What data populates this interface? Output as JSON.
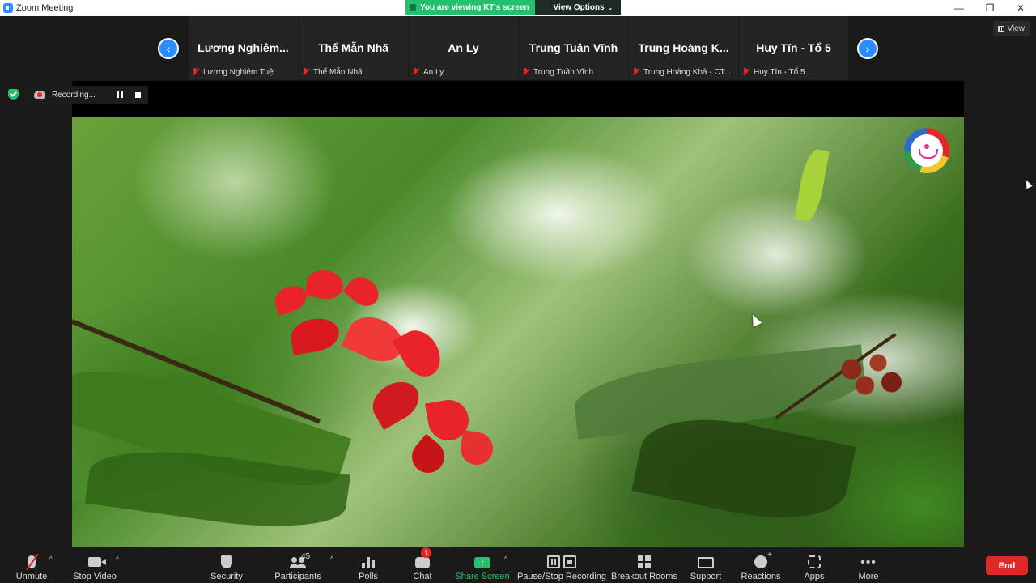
{
  "window": {
    "title": "Zoom Meeting",
    "minimize": "—",
    "restore": "❐",
    "close": "✕"
  },
  "banner": {
    "viewing_text": "You are viewing KT's screen",
    "view_options": "View Options"
  },
  "view_button": "View",
  "gallery": {
    "tiles": [
      {
        "display_name": "Lương  Nghiêm...",
        "label": "Lương Nghiêm Tuệ"
      },
      {
        "display_name": "Thể Mẫn Nhã",
        "label": "Thể Mẫn Nhã"
      },
      {
        "display_name": "An Ly",
        "label": "An Ly"
      },
      {
        "display_name": "Trung Tuân Vĩnh",
        "label": "Trung Tuân Vĩnh"
      },
      {
        "display_name": "Trung Hoàng K...",
        "label": "Trung Hoàng Khả - CT..."
      },
      {
        "display_name": "Huy Tín - Tổ 5",
        "label": "Huy Tín - Tổ 5"
      }
    ]
  },
  "recording": {
    "status": "Recording..."
  },
  "toolbar": {
    "unmute": "Unmute",
    "stop_video": "Stop Video",
    "security": "Security",
    "participants": "Participants",
    "participant_count": "45",
    "polls": "Polls",
    "chat": "Chat",
    "chat_badge": "1",
    "share_screen": "Share Screen",
    "pause_stop_recording": "Pause/Stop Recording",
    "breakout_rooms": "Breakout Rooms",
    "support": "Support",
    "reactions": "Reactions",
    "apps": "Apps",
    "more": "More",
    "end": "End"
  },
  "colors": {
    "accent_blue": "#2d8cff",
    "share_green": "#23c16b",
    "end_red": "#e02828"
  }
}
